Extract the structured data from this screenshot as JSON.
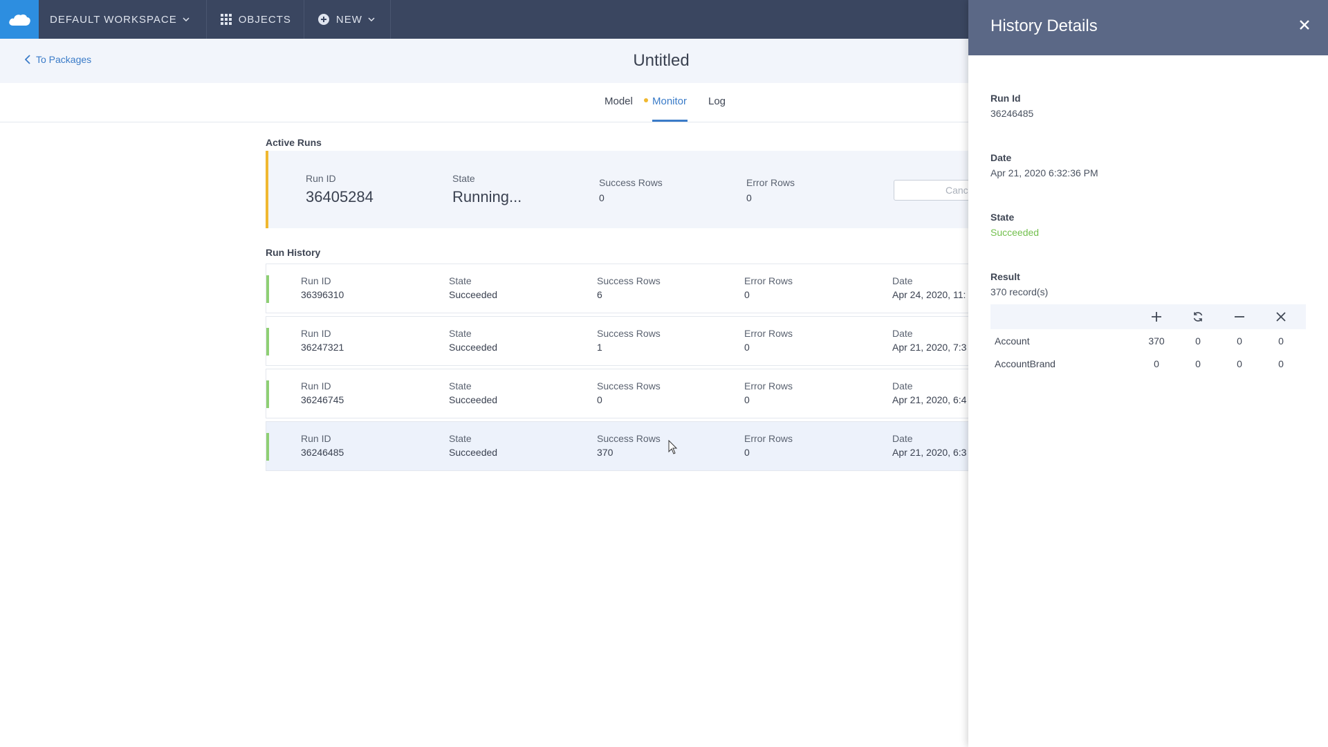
{
  "topnav": {
    "workspace_label": "DEFAULT WORKSPACE",
    "objects_label": "OBJECTS",
    "new_label": "NEW"
  },
  "subheader": {
    "back_label": "To Packages",
    "title": "Untitled"
  },
  "tabs": [
    {
      "label": "Model"
    },
    {
      "label": "Monitor"
    },
    {
      "label": "Log"
    }
  ],
  "active_runs": {
    "title": "Active Runs",
    "run_id_label": "Run ID",
    "run_id": "36405284",
    "state_label": "State",
    "state": "Running...",
    "success_label": "Success Rows",
    "success": "0",
    "error_label": "Error Rows",
    "error": "0",
    "cancel_label": "Cancel"
  },
  "run_history": {
    "title": "Run History",
    "labels": {
      "run_id": "Run ID",
      "state": "State",
      "success": "Success Rows",
      "error": "Error Rows",
      "date": "Date"
    },
    "rows": [
      {
        "run_id": "36396310",
        "state": "Succeeded",
        "success": "6",
        "error": "0",
        "date": "Apr 24, 2020, 11:"
      },
      {
        "run_id": "36247321",
        "state": "Succeeded",
        "success": "1",
        "error": "0",
        "date": "Apr 21, 2020, 7:3"
      },
      {
        "run_id": "36246745",
        "state": "Succeeded",
        "success": "0",
        "error": "0",
        "date": "Apr 21, 2020, 6:4"
      },
      {
        "run_id": "36246485",
        "state": "Succeeded",
        "success": "370",
        "error": "0",
        "date": "Apr 21, 2020, 6:3"
      }
    ]
  },
  "panel": {
    "title": "History Details",
    "run_id_label": "Run Id",
    "run_id": "36246485",
    "date_label": "Date",
    "date": "Apr 21, 2020 6:32:36 PM",
    "state_label": "State",
    "state": "Succeeded",
    "result_label": "Result",
    "result": "370 record(s)",
    "result_rows": [
      {
        "name": "Account",
        "inserted": "370",
        "updated": "0",
        "deleted": "0",
        "failed": "0"
      },
      {
        "name": "AccountBrand",
        "inserted": "0",
        "updated": "0",
        "deleted": "0",
        "failed": "0"
      }
    ]
  },
  "colors": {
    "topbar": "#3a4660",
    "logo": "#2d8ee0",
    "accent": "#3a7bc8",
    "running": "#f0b830",
    "succeeded": "#73c04e",
    "panel_header": "#5b6886"
  }
}
